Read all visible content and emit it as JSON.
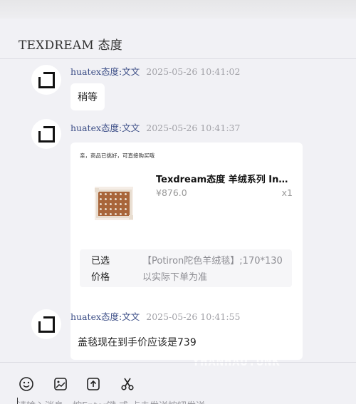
{
  "header": {
    "title": "TEXDREAM 态度"
  },
  "messages": [
    {
      "sender": "huatex态度:文文",
      "time": "2025-05-26 10:41:02",
      "text": "稍等"
    },
    {
      "sender": "huatex态度:文文",
      "time": "2025-05-26 10:41:37",
      "card": {
        "hint": "亲，商品已挑好，可直接购买哦",
        "product_name": "Texdream态度 羊绒系列 Ins...",
        "price": "¥876.0",
        "qty": "x1",
        "spec_label": "已选",
        "spec_value": "【Potiron陀色羊绒毯】;170*130",
        "price_label": "价格",
        "price_value": "以实际下单为准"
      }
    },
    {
      "sender": "huatex态度:文文",
      "time": "2025-05-26 10:41:55",
      "text": "盖毯现在到手价应该是739"
    }
  ],
  "watermark": "YHANHAU.UNK",
  "toolbar": {
    "icons": [
      "emoji-icon",
      "image-icon",
      "upload-icon",
      "scissors-icon"
    ]
  },
  "input": {
    "placeholder": "请输入消息，按Enter键 或 点击发送按钮发送"
  },
  "colors": {
    "sender": "#3b4d86",
    "time": "#a2a2a8",
    "background": "#f1f1f5"
  }
}
